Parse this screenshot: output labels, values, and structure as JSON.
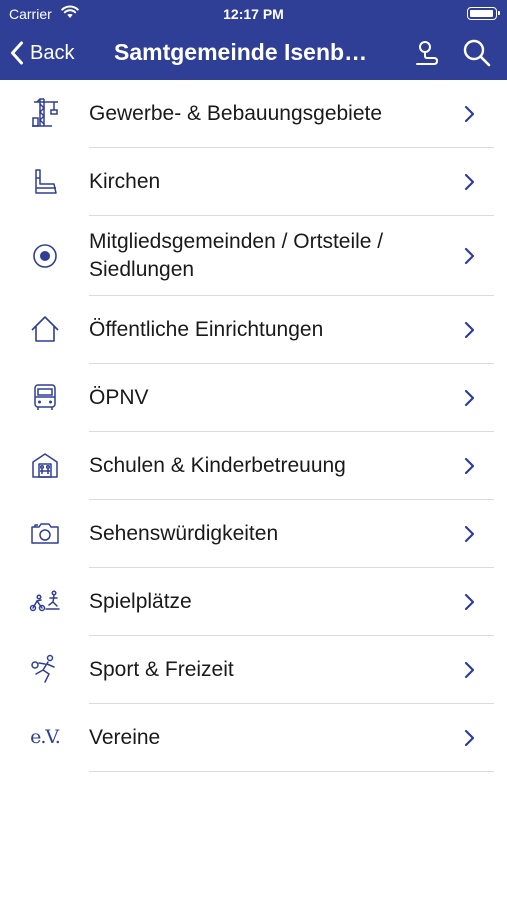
{
  "status_bar": {
    "carrier": "Carrier",
    "time": "12:17 PM"
  },
  "nav_bar": {
    "back_label": "Back",
    "title": "Samtgemeinde Isenb…"
  },
  "colors": {
    "accent": "#2f3f95",
    "separator": "#dcdcdc"
  },
  "items": [
    {
      "label": "Gewerbe- & Bebauungsgebiete",
      "icon": "crane-icon"
    },
    {
      "label": "Kirchen",
      "icon": "church-pew-icon"
    },
    {
      "label": "Mitgliedsgemeinden / Ortsteile / Siedlungen",
      "icon": "target-dot-icon"
    },
    {
      "label": "Öffentliche Einrichtungen",
      "icon": "house-icon"
    },
    {
      "label": "ÖPNV",
      "icon": "bus-icon"
    },
    {
      "label": "Schulen & Kinderbetreuung",
      "icon": "school-icon"
    },
    {
      "label": "Sehenswürdigkeiten",
      "icon": "camera-icon"
    },
    {
      "label": "Spielplätze",
      "icon": "playground-icon"
    },
    {
      "label": "Sport & Freizeit",
      "icon": "sport-runner-icon"
    },
    {
      "label": "Vereine",
      "icon": "ev-icon",
      "icon_text": "e.V."
    }
  ]
}
